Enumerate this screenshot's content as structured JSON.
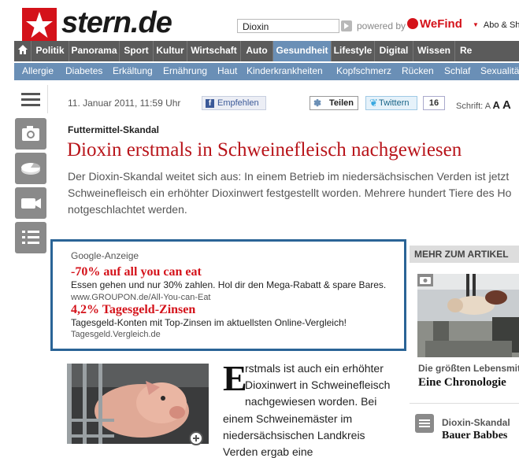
{
  "header": {
    "logo_text": "stern.de",
    "search_value": "Dioxin",
    "powered_by": "powered by",
    "wefind": "WeFind",
    "abo_link": "Abo & Sh"
  },
  "nav_main": [
    {
      "label": "Politik"
    },
    {
      "label": "Panorama"
    },
    {
      "label": "Sport"
    },
    {
      "label": "Kultur"
    },
    {
      "label": "Wirtschaft"
    },
    {
      "label": "Auto"
    },
    {
      "label": "Gesundheit",
      "active": true
    },
    {
      "label": "Lifestyle"
    },
    {
      "label": "Digital"
    },
    {
      "label": "Wissen"
    },
    {
      "label": "Re"
    }
  ],
  "nav_sub": [
    {
      "label": "Allergie"
    },
    {
      "label": "Diabetes"
    },
    {
      "label": "Erkältung"
    },
    {
      "label": "Ernährung"
    },
    {
      "label": "Haut"
    },
    {
      "label": "Kinderkrankheiten"
    },
    {
      "label": "Kopfschmerz"
    },
    {
      "label": "Rücken"
    },
    {
      "label": "Schlaf"
    },
    {
      "label": "Sexualitä"
    }
  ],
  "article": {
    "date": "11. Januar 2011, 11:59 Uhr",
    "facebook_label": "Empfehlen",
    "share_label": "Teilen",
    "twitter_label": "Twittern",
    "twitter_count": "16",
    "font_size_label": "Schrift:",
    "font_sizes": [
      "A",
      "A",
      "A"
    ],
    "kicker": "Futtermittel-Skandal",
    "headline": "Dioxin erstmals in Schweinefleisch nachgewiesen",
    "teaser_lines": [
      "Der Dioxin-Skandal weitet sich aus: In einem Betrieb im niedersächsischen Verden ist jetzt",
      "Schweinefleisch ein erhöhter Dioxinwert festgestellt worden. Mehrere hundert Tiere des Ho",
      "notgeschlachtet werden."
    ],
    "dropcap": "E",
    "body_lines": [
      "rstmals ist auch ein erhöhter",
      "Dioxinwert in Schweinefleisch",
      "nachgewiesen worden. Bei",
      "einem Schweinemäster im",
      "niedersächsischen Landkreis",
      "Verden ergab eine"
    ]
  },
  "ad": {
    "header": "Google-Anzeige",
    "items": [
      {
        "title": "-70% auf all you can eat",
        "text": "Essen gehen und nur 30% zahlen. Hol dir den Mega-Rabatt & spare Bares.",
        "url": "www.GROUPON.de/All-You-can-Eat"
      },
      {
        "title": "4,2% Tagesgeld-Zinsen",
        "text": "Tagesgeld-Konten mit Top-Zinsen im aktuellsten Online-Vergleich!",
        "url": "Tagesgeld.Vergleich.de"
      }
    ]
  },
  "sidebar_right": {
    "header": "MEHR ZUM ARTIKEL",
    "item1_kicker": "Die größten Lebensmit",
    "item1_title": "Eine Chronologie",
    "item2_kicker": "Dioxin-Skandal",
    "item2_title": "Bauer Babbes"
  },
  "colors": {
    "brand_red": "#d4121a",
    "headline_red": "#b8141a",
    "nav_dark": "#5b5b5b",
    "nav_blue": "#6a8fb6",
    "ad_border": "#2a6496"
  }
}
